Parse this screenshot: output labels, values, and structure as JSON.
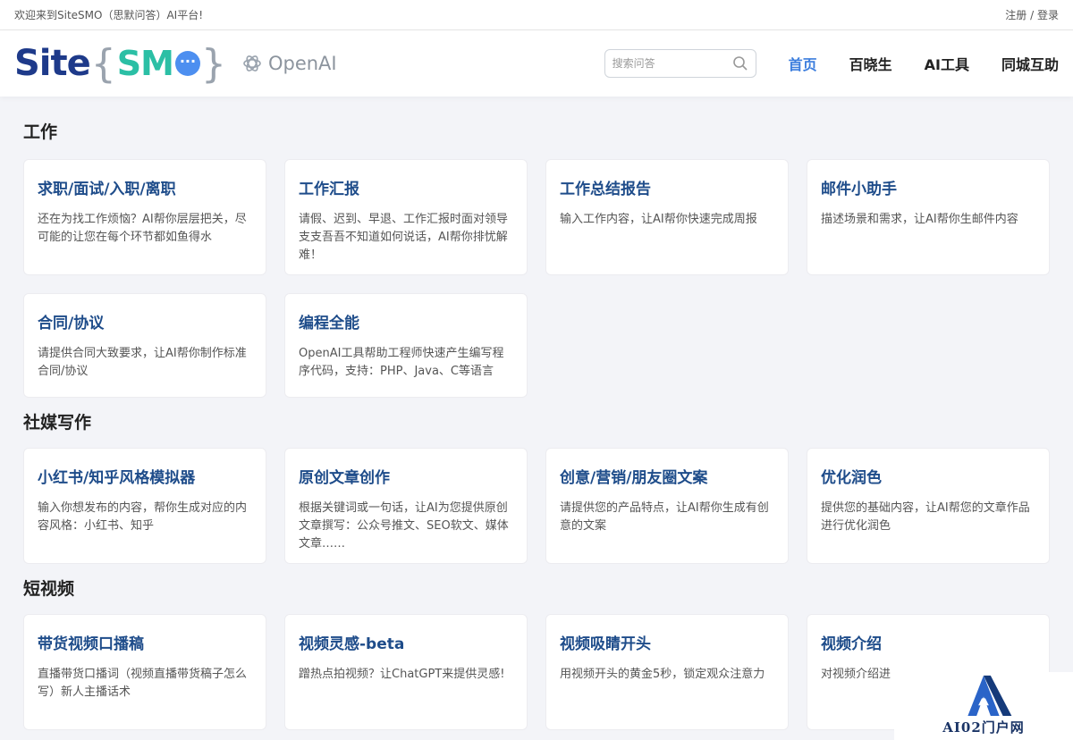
{
  "topbar": {
    "welcome": "欢迎来到SiteSMO（思默问答）AI平台!",
    "register": "注册",
    "separator": " / ",
    "login": "登录"
  },
  "header": {
    "logo_site": "Site",
    "logo_brace_open": "{",
    "logo_smo": "SM",
    "logo_brace_close": "}",
    "partner": "OpenAI",
    "search_placeholder": "搜索问答",
    "nav": [
      {
        "label": "首页",
        "active": true
      },
      {
        "label": "百晓生",
        "active": false
      },
      {
        "label": "AI工具",
        "active": false
      },
      {
        "label": "同城互助",
        "active": false
      }
    ]
  },
  "sections": [
    {
      "title": "工作",
      "cards": [
        {
          "title": "求职/面试/入职/离职",
          "desc": "还在为找工作烦恼？AI帮你层层把关，尽可能的让您在每个环节都如鱼得水"
        },
        {
          "title": "工作汇报",
          "desc": "请假、迟到、早退、工作汇报时面对领导支支吾吾不知道如何说话，AI帮你排忧解难！"
        },
        {
          "title": "工作总结报告",
          "desc": "输入工作内容，让AI帮你快速完成周报"
        },
        {
          "title": "邮件小助手",
          "desc": "描述场景和需求，让AI帮你生邮件内容"
        },
        {
          "title": "合同/协议",
          "desc": "请提供合同大致要求，让AI帮你制作标准合同/协议"
        },
        {
          "title": "编程全能",
          "desc": "OpenAI工具帮助工程师快速产生编写程序代码，支持：PHP、Java、C等语言"
        }
      ]
    },
    {
      "title": "社媒写作",
      "cards": [
        {
          "title": "小红书/知乎风格模拟器",
          "desc": "输入你想发布的内容，帮你生成对应的内容风格：小红书、知乎"
        },
        {
          "title": "原创文章创作",
          "desc": "根据关键词或一句话，让AI为您提供原创文章撰写：公众号推文、SEO软文、媒体文章……"
        },
        {
          "title": "创意/营销/朋友圈文案",
          "desc": "请提供您的产品特点，让AI帮你生成有创意的文案"
        },
        {
          "title": "优化润色",
          "desc": "提供您的基础内容，让AI帮您的文章作品进行优化润色"
        }
      ]
    },
    {
      "title": "短视频",
      "cards": [
        {
          "title": "带货视频口播稿",
          "desc": "直播带货口播词（视频直播带货稿子怎么写）新人主播话术"
        },
        {
          "title": "视频灵感-beta",
          "desc": "蹭热点拍视频？让ChatGPT来提供灵感!"
        },
        {
          "title": "视频吸睛开头",
          "desc": "用视频开头的黄金5秒，锁定观众注意力"
        },
        {
          "title": "视频介绍",
          "desc": "对视频介绍进"
        }
      ]
    }
  ],
  "watermark": {
    "text": "AI02门户网"
  },
  "colors": {
    "accent": "#3b7ddd",
    "card_title": "#1e4c8a",
    "logo_blue": "#1e3a8a",
    "logo_teal": "#2bbfa5"
  }
}
